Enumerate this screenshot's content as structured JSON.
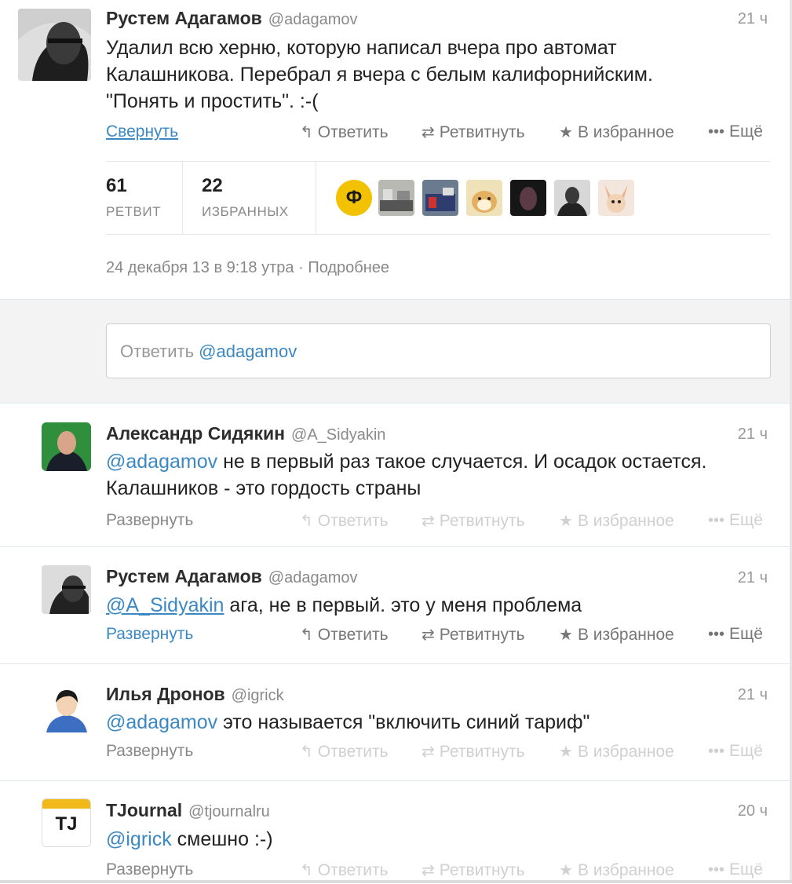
{
  "main_tweet": {
    "author_name": "Рустем Адагамов",
    "author_handle": "@adagamov",
    "time": "21 ч",
    "text_line1": "Удалил всю херню, которую написал вчера про автомат",
    "text_line2": "Калашникова. Перебрал я вчера с белым калифорнийским.",
    "text_line3": "\"Понять и простить\". :-(",
    "collapse_label": "Свернуть",
    "reply_label": "Ответить",
    "retweet_label": "Ретвитнуть",
    "favorite_label": "В избранное",
    "more_label": "Ещё",
    "retweets_count": "61",
    "retweets_label": "РЕТВИТ",
    "favorites_count": "22",
    "favorites_label": "ИЗБРАННЫХ",
    "date": "24 декабря 13 в 9:18 утра",
    "details_label": "Подробнее"
  },
  "reply_box": {
    "placeholder_prefix": "Ответить ",
    "placeholder_mention": "@adagamov"
  },
  "replies": [
    {
      "author_name": "Александр Сидякин",
      "author_handle": "@A_Sidyakin",
      "time": "21 ч",
      "mention": "@adagamov",
      "text_line1": " не в первый раз такое случается. И осадок остается.",
      "text_line2": "Калашников - это гордость страны",
      "expand_label": "Развернуть",
      "reply_label": "Ответить",
      "retweet_label": "Ретвитнуть",
      "favorite_label": "В избранное",
      "more_label": "Ещё"
    },
    {
      "author_name": "Рустем Адагамов",
      "author_handle": "@adagamov",
      "time": "21 ч",
      "mention": "@A_Sidyakin",
      "text_line1": " ага, не в первый. это у меня проблема",
      "expand_label": "Развернуть",
      "reply_label": "Ответить",
      "retweet_label": "Ретвитнуть",
      "favorite_label": "В избранное",
      "more_label": "Ещё"
    },
    {
      "author_name": "Илья Дронов",
      "author_handle": "@igrick",
      "time": "21 ч",
      "mention": "@adagamov",
      "text_line1": " это называется \"включить синий тариф\"",
      "expand_label": "Развернуть",
      "reply_label": "Ответить",
      "retweet_label": "Ретвитнуть",
      "favorite_label": "В избранное",
      "more_label": "Ещё"
    },
    {
      "author_name": "TJournal",
      "author_handle": "@tjournalru",
      "time": "20 ч",
      "mention": "@igrick",
      "text_line1": " смешно :-)",
      "avatar_text": "TJ",
      "expand_label": "Развернуть",
      "reply_label": "Ответить",
      "retweet_label": "Ретвитнуть",
      "favorite_label": "В избранное",
      "more_label": "Ещё"
    }
  ],
  "favoriter_badge": "Ф",
  "icons": {
    "reply": "reply-arrow-icon",
    "retweet": "retweet-icon",
    "favorite": "star-icon",
    "more": "more-dots-icon"
  },
  "colors": {
    "link": "#3b88c3",
    "muted": "#888888",
    "faded_action": "#d0d0d0",
    "reply_area_bg": "#f3f3f3"
  }
}
